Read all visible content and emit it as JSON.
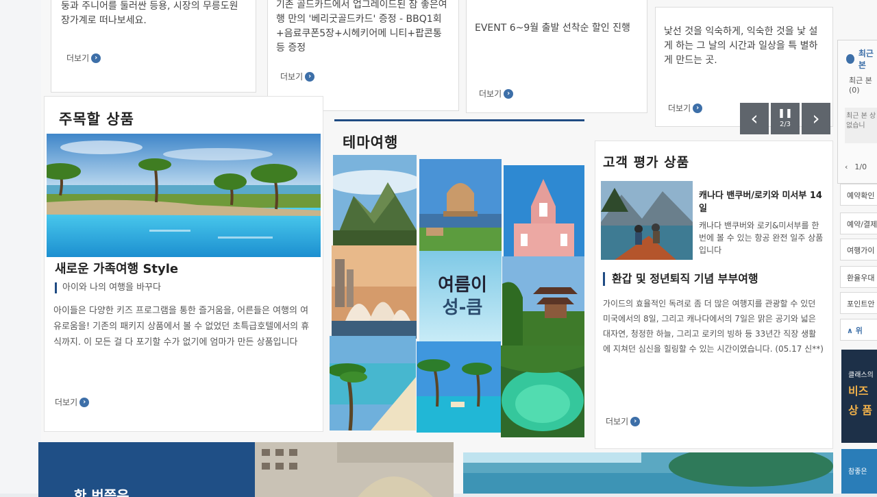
{
  "promos": [
    {
      "text": "둥과 주니어를 둘러싼 등용, 시장의 무릉도원 장가계로 떠나보세요.",
      "more": "더보기"
    },
    {
      "text": "기존 골드카드에서 업그레이드된 잠 좋은여행 만의 '베리굿골드카드' 증정 - BBQ1회+음료쿠폰5장+시헤키어메 니티+팝콘통 등 증정",
      "more": "더보기"
    },
    {
      "text": "EVENT 6~9월 출발 선착순 할인 진행",
      "more": "더보기"
    },
    {
      "text": "낯선 것을 익숙하게, 익숙한 것을 낯 설게 하는 그 날의 시간과 일상을 특 별하게 만드는 곳.",
      "more": "더보기"
    }
  ],
  "carousel": {
    "prev": "‹",
    "pause": "❚❚",
    "page": "2/3",
    "next": "›"
  },
  "featured": {
    "title": "주목할 상품",
    "product_title": "새로운 가족여행 Style",
    "subtitle": "아이와 나의 여행을 바꾸다",
    "description": "아이들은 다양한 키즈 프로그램을 통한 즐거움을, 어른들은 여행의 여유로움을! 기존의 패키지 상품에서 볼 수 없었던 초특급호텔에서의 휴식까지. 이 모든 걸 다 포기할 수가 없기에 엄마가 만든 상품입니다",
    "more": "더보기"
  },
  "theme": {
    "title": "테마여행",
    "center_line1": "여름이",
    "center_line2": "성-큼"
  },
  "review": {
    "title": "고객 평가 상품",
    "product_name": "캐나다 밴쿠버/로키와 미서부 14일",
    "product_desc": "캐나다 밴쿠버와 로키&미서부를 한 번에 볼 수 있는 항공 완전 일주 상품입니다",
    "headline": "환갑 및 정년퇴직 기념 부부여행",
    "body": "가이드의 효율적인 독려로 좀 더 많은 여행지를 관광할 수 있던 미국에서의 8일, 그리고 캐나다에서의 7일은 맑은 공기와 넓은 대자연, 청정한 하늘, 그리고 로키의 빙하 등 33년간 직장 생활에 지쳐던 심신을 힐링할 수 있는 시간이였습니다. (05.17 신**)",
    "more": "더보기"
  },
  "sidebar": {
    "header": "최근본",
    "recent_label": "최근 본",
    "recent_count": "(0)",
    "empty_text": "최근 본 상 없습니",
    "pager": "1/0",
    "items": [
      "예약확인",
      "예약/결제",
      "여행가이",
      "환율우대",
      "포인트안"
    ],
    "top": "∧ 위",
    "banner_line1": "클래스의",
    "banner_line2": "비즈",
    "banner_line3": "상 품",
    "banner2": "참좋은"
  },
  "bottom": {
    "banner_text": "한 번쯤은"
  },
  "colors": {
    "accent_blue": "#3d6fa8",
    "dark_blue": "#1f4b83",
    "ctrl_gray": "#5f656c"
  }
}
